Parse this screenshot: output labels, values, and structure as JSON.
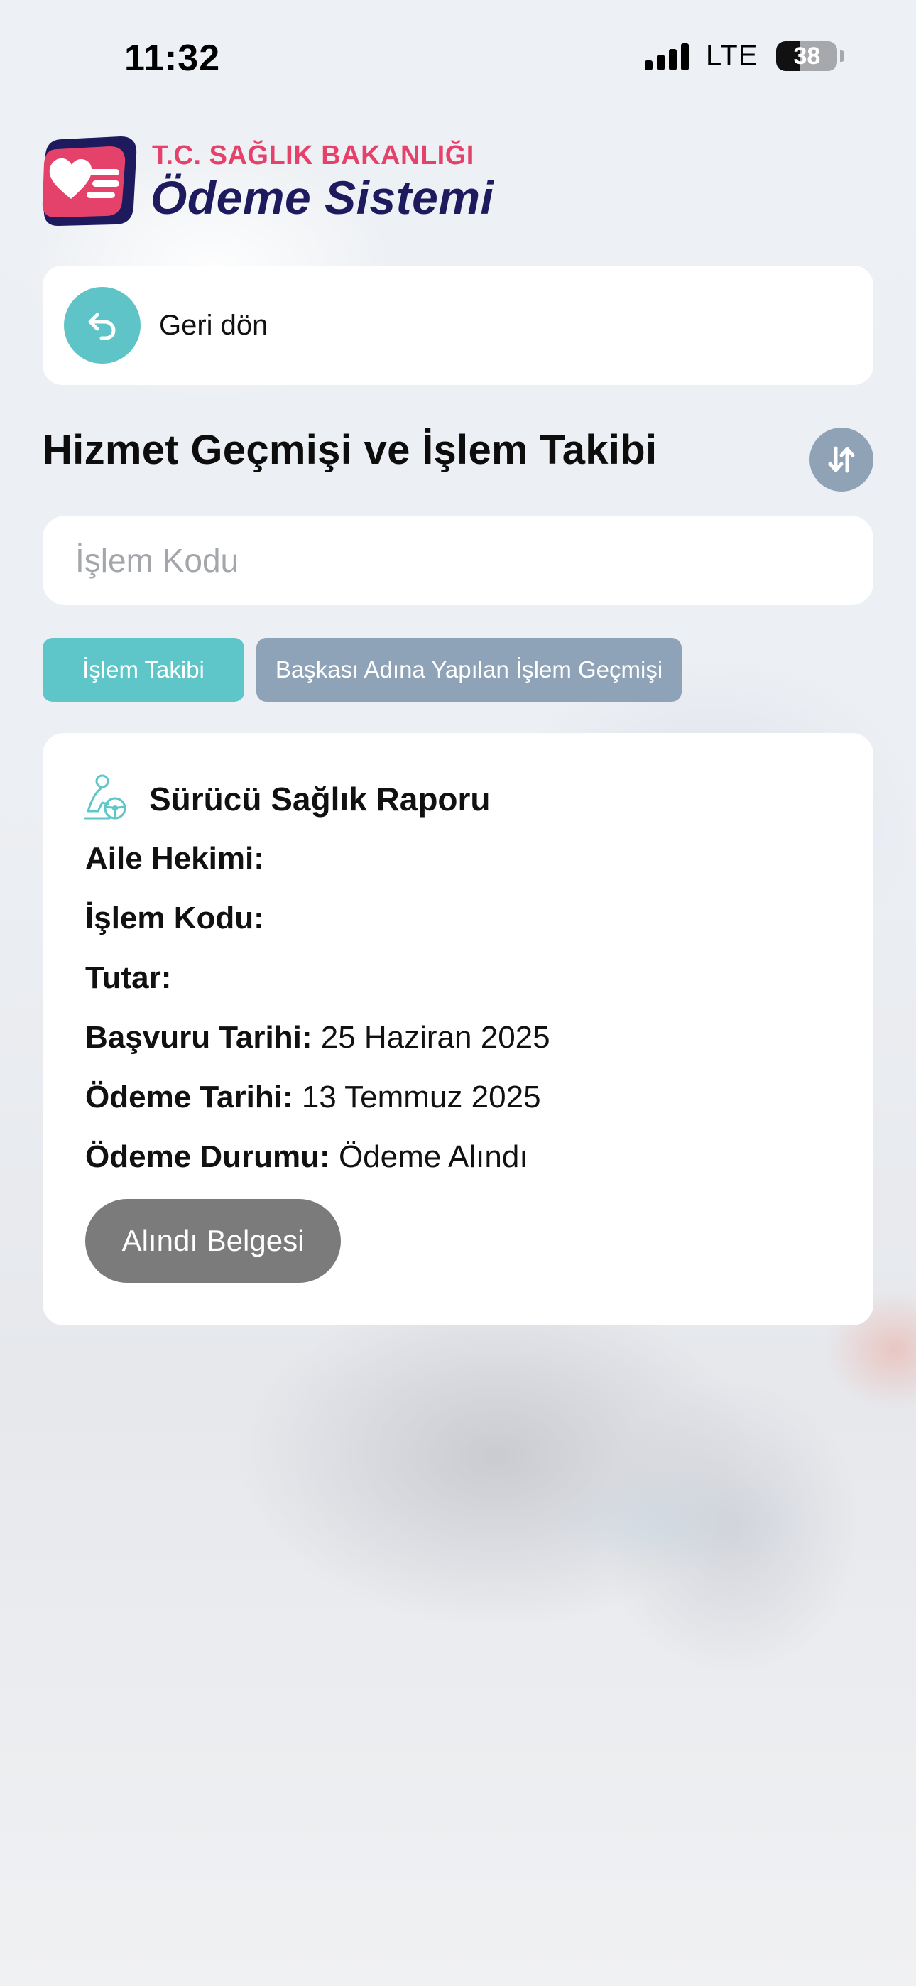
{
  "status_bar": {
    "time": "11:32",
    "network": "LTE",
    "battery": "38",
    "battery_level": 0.38
  },
  "brand": {
    "line1": "T.C. SAĞLIK BAKANLIĞI",
    "line2": "Ödeme Sistemi",
    "accent_red": "#e5426b",
    "accent_navy": "#1d1a5e"
  },
  "back": {
    "label": "Geri dön",
    "icon": "undo-arrow-icon"
  },
  "page": {
    "title": "Hizmet Geçmişi ve İşlem Takibi",
    "sort_icon": "sort-arrows-icon"
  },
  "search": {
    "placeholder": "İşlem Kodu",
    "value": ""
  },
  "tabs": [
    {
      "label": "İşlem Takibi",
      "color": "#5ec6c8"
    },
    {
      "label": "Başkası Adına Yapılan İşlem Geçmişi",
      "color": "#8ea3b7"
    }
  ],
  "record": {
    "icon": "driver-person-icon",
    "title": "Sürücü Sağlık Raporu",
    "fields": [
      {
        "label": "Aile Hekimi:",
        "value": ""
      },
      {
        "label": "İşlem Kodu:",
        "value": ""
      },
      {
        "label": "Tutar:",
        "value": ""
      },
      {
        "label": "Başvuru Tarihi:",
        "value": "25 Haziran 2025"
      },
      {
        "label": "Ödeme Tarihi:",
        "value": "13 Temmuz 2025"
      },
      {
        "label": "Ödeme Durumu:",
        "value": "Ödeme Alındı"
      }
    ],
    "receipt_button": "Alındı Belgesi"
  }
}
